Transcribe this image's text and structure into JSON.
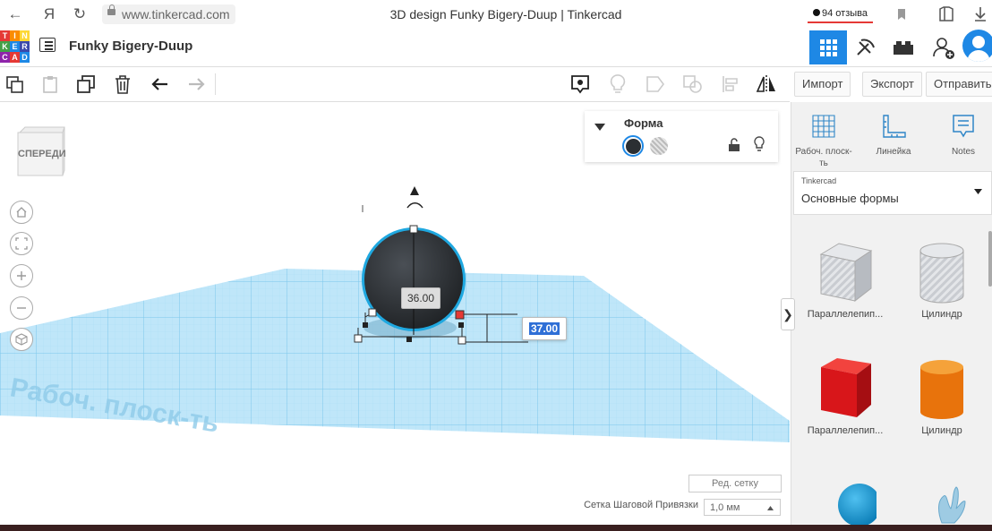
{
  "browser": {
    "back_icon": "arrow-left-icon",
    "yandex_label": "Я",
    "reload_icon": "reload-icon",
    "url": "www.tinkercad.com",
    "page_title": "3D design Funky Bigery-Duup | Tinkercad",
    "reviews_label": "94 отзыва"
  },
  "app": {
    "logo_letters": [
      "T",
      "I",
      "N",
      "K",
      "E",
      "R",
      "C",
      "A",
      "D"
    ],
    "logo_colors": [
      "#e53935",
      "#fb8c00",
      "#fdd835",
      "#43a047",
      "#1e88e5",
      "#3949ab",
      "#8e24aa",
      "#e53935",
      "#1e88e5"
    ],
    "design_name": "Funky Bigery-Duup",
    "accent": "#1e88e5"
  },
  "toolbar": {
    "buttons": [
      "copy-icon",
      "paste-icon",
      "duplicate-icon",
      "delete-icon",
      "undo-icon",
      "redo-icon"
    ],
    "right_buttons": [
      "notes-toggle-icon",
      "light-bulb-icon",
      "group-icon",
      "ungroup-icon",
      "align-icon",
      "mirror-icon"
    ],
    "import_label": "Импорт",
    "export_label": "Экспорт",
    "send_label": "Отправить"
  },
  "viewcube": {
    "label": "СПЕРЕДИ"
  },
  "shape_panel": {
    "title": "Форма",
    "solid_color": "#2b2f33"
  },
  "workplane": {
    "label": "Рабоч. плоск-ть",
    "dim_width": "36.00",
    "dim_height": "37.00",
    "edit_grid": "Ред. сетку",
    "snap_label": "Сетка Шаговой Привязки",
    "snap_value": "1,0 мм",
    "grid_color": "#7fc8ee"
  },
  "right_panel": {
    "tools": [
      {
        "label": "Рабоч. плоск-ть",
        "icon": "workplane-icon"
      },
      {
        "label": "Линейка",
        "icon": "ruler-icon"
      },
      {
        "label": "Notes",
        "icon": "notes-icon"
      }
    ],
    "library_caption": "Tinkercad",
    "library_name": "Основные формы",
    "shapes": [
      {
        "label": "Параллелепип...",
        "icon": "hole-box-icon"
      },
      {
        "label": "Цилиндр",
        "icon": "hole-cylinder-icon"
      },
      {
        "label": "Параллелепип...",
        "icon": "box-icon"
      },
      {
        "label": "Цилиндр",
        "icon": "cylinder-icon"
      },
      {
        "label": "",
        "icon": "sphere-icon"
      },
      {
        "label": "",
        "icon": "scribble-icon"
      }
    ]
  }
}
